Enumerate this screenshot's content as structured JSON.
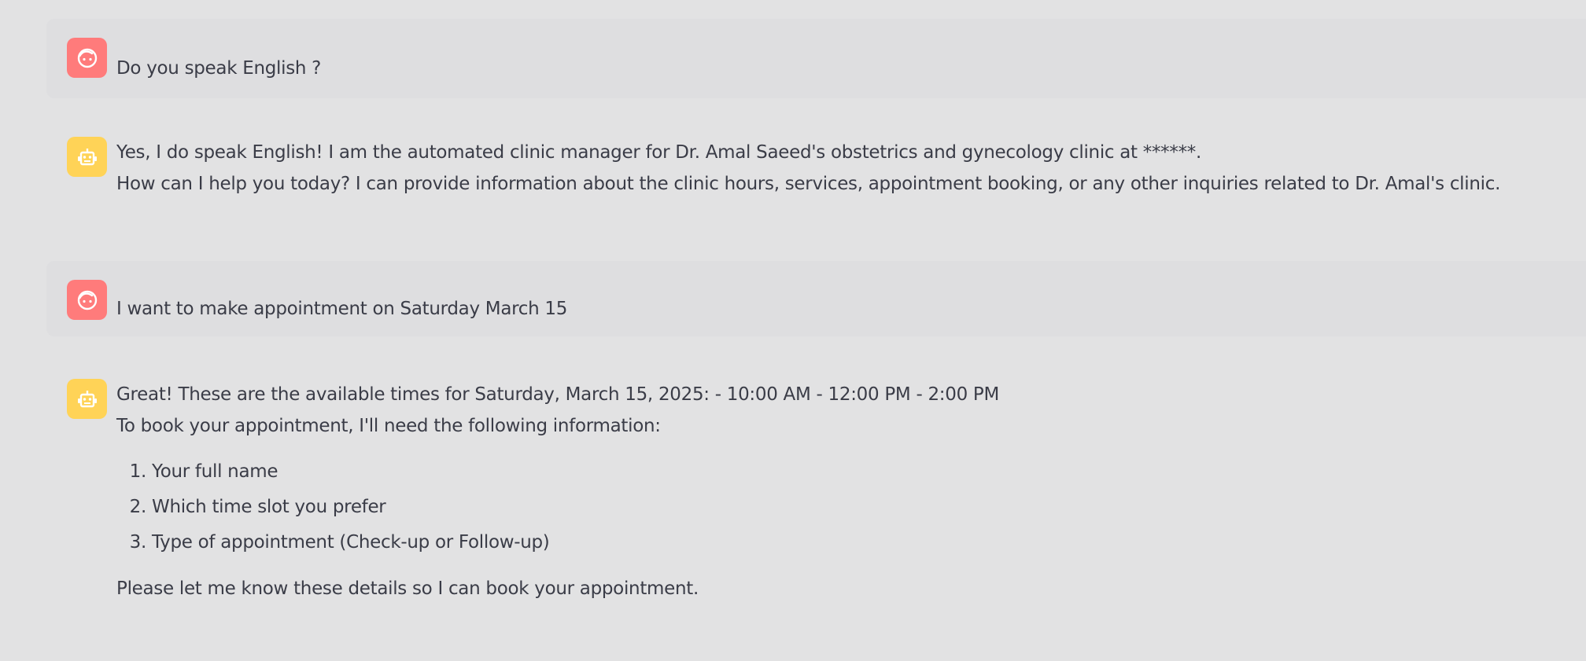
{
  "colors": {
    "background": "#e2e2e3",
    "user_row": "#dedee0",
    "user_avatar": "#ff7b7b",
    "assistant_avatar": "#ffd357",
    "text": "#3a3c47"
  },
  "messages": [
    {
      "role": "user",
      "avatar_icon": "user-face-icon",
      "text": "Do you speak English ?"
    },
    {
      "role": "assistant",
      "avatar_icon": "robot-icon",
      "lines": [
        "Yes, I do speak English! I am the automated clinic manager for Dr. Amal Saeed's obstetrics and gynecology clinic at ******.",
        "How can I help you today? I can provide information about the clinic hours, services, appointment booking, or any other inquiries related to Dr. Amal's clinic."
      ]
    },
    {
      "role": "user",
      "avatar_icon": "user-face-icon",
      "text": "I want to make appointment on Saturday March 15"
    },
    {
      "role": "assistant",
      "avatar_icon": "robot-icon",
      "lines": [
        "Great! These are the available times for Saturday, March 15, 2025: - 10:00 AM - 12:00 PM - 2:00 PM",
        "To book your appointment, I'll need the following information:"
      ],
      "list": [
        "Your full name",
        "Which time slot you prefer",
        "Type of appointment (Check-up or Follow-up)"
      ],
      "closing": "Please let me know these details so I can book your appointment."
    }
  ]
}
